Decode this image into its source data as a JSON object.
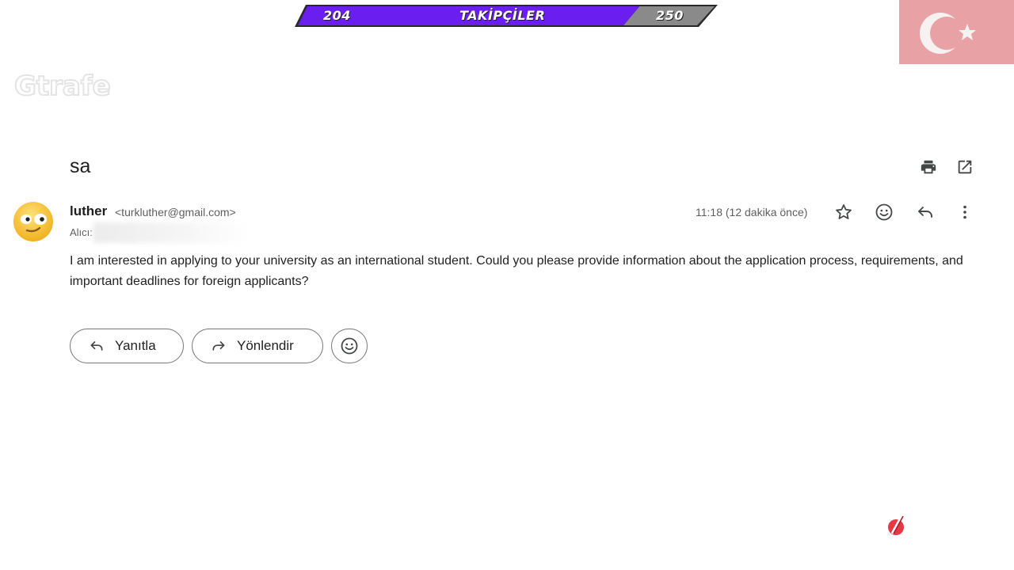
{
  "overlay": {
    "followers_current": "204",
    "followers_title": "TAKİPÇİLER",
    "followers_goal": "250",
    "progress_fraction": 0.816,
    "bar_color": "#6a1ef0",
    "goal_color": "#8a8a8a"
  },
  "email": {
    "subject": "sa",
    "sender_name": "luther",
    "sender_email": "<turkluther@gmail.com>",
    "to_label": "Alıcı:",
    "time": "11:18 (12 dakika önce)",
    "body": "I am interested in applying to your university as an international student. Could you please provide information about the application process, requirements, and important deadlines for foreign applicants?"
  },
  "actions": {
    "reply_label": "Yanıtla",
    "forward_label": "Yönlendir"
  },
  "icons": {
    "print": "print-icon",
    "open": "open-in-new-icon",
    "star": "star-icon",
    "emoji": "emoji-icon",
    "reply": "reply-icon",
    "more": "more-vert-icon",
    "forward": "forward-icon"
  },
  "colors": {
    "accent_purple": "#6a1ef0",
    "flag_red": "#e30a17"
  }
}
